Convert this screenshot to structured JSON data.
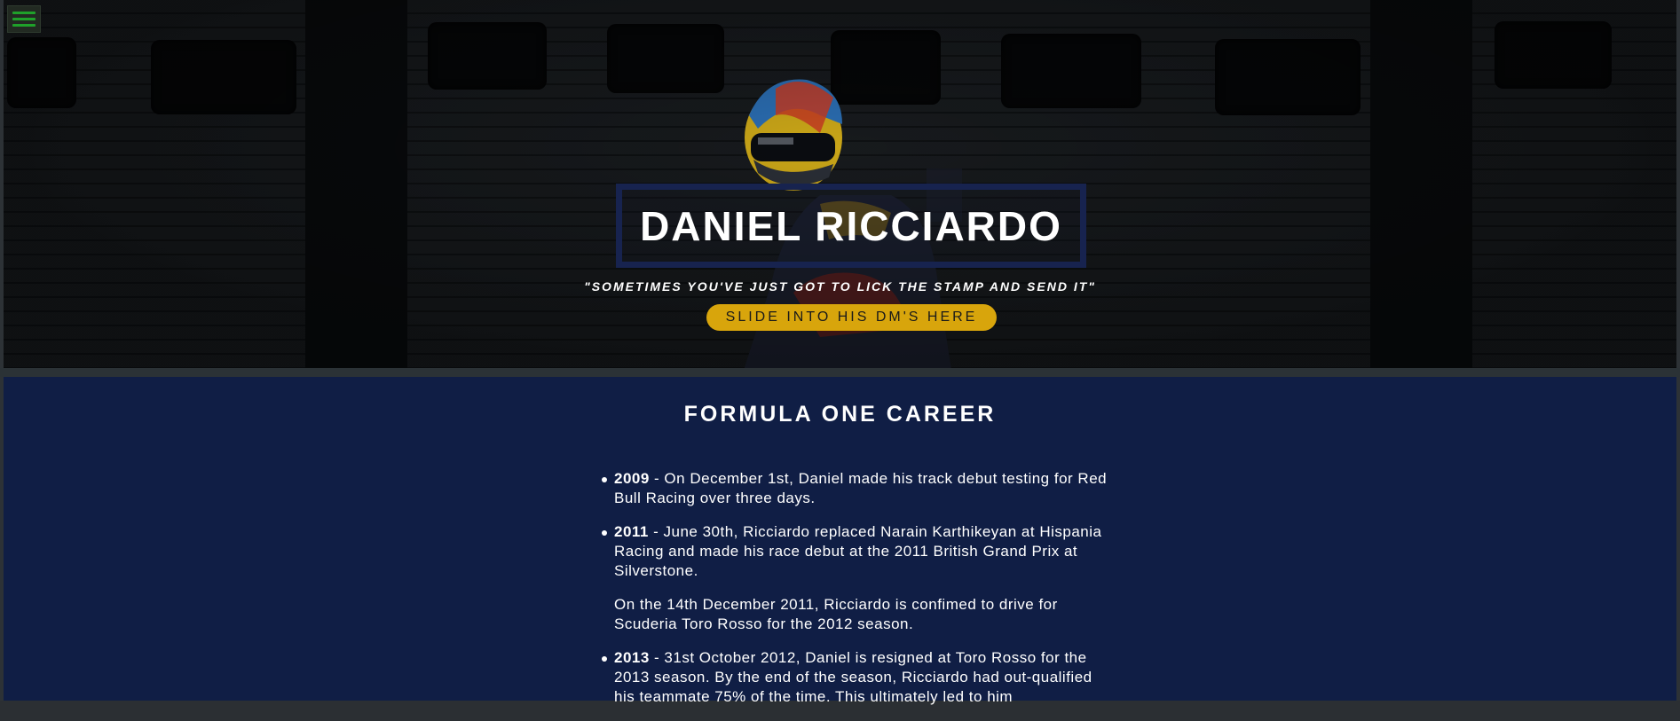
{
  "hero": {
    "menu_icon": "hamburger-menu-icon",
    "title": "DANIEL RICCIARDO",
    "quote": "\"SOMETIMES YOU'VE JUST GOT TO LICK THE STAMP AND SEND IT\"",
    "cta_label": "SLIDE INTO HIS DM'S HERE"
  },
  "career": {
    "heading": "FORMULA ONE CAREER",
    "items": [
      {
        "year": "2009",
        "text": " - On December 1st, Daniel made his track debut testing for Red Bull Racing over three days."
      },
      {
        "year": "2011",
        "text": " - June 30th, Ricciardo replaced Narain Karthikeyan at Hispania Racing and made his race debut at the 2011 British Grand Prix at Silverstone."
      },
      {
        "year": "",
        "text": "On the 14th December 2011, Ricciardo is confimed to drive for Scuderia Toro Rosso for the 2012 season."
      },
      {
        "year": "2013",
        "text": " - 31st October 2012, Daniel is resigned at Toro Rosso for the 2013 season. By the end of the season, Ricciardo had out-qualified his teammate 75% of the time. This ultimately led to him"
      }
    ]
  },
  "colors": {
    "career_bg": "#101e45",
    "title_border": "#17234f",
    "cta_bg": "#d8a50c",
    "menu_icon": "#1fa12a"
  }
}
